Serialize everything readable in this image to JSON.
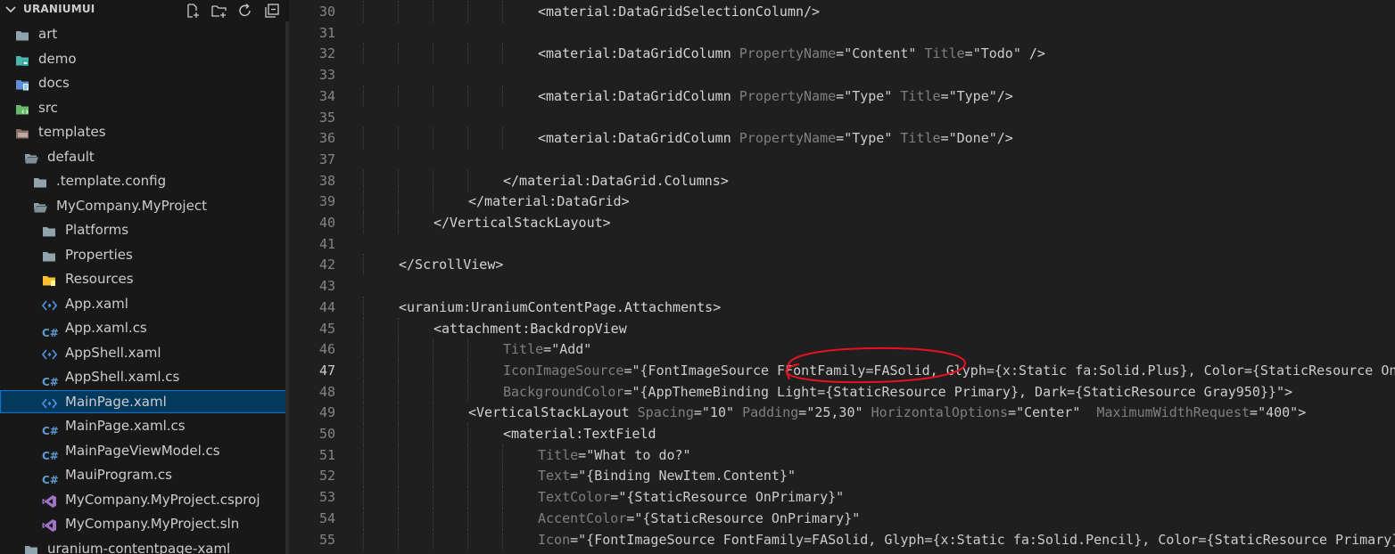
{
  "explorer": {
    "title": "URANIUMUI",
    "actions": [
      "new-file-icon",
      "new-folder-icon",
      "refresh-icon",
      "collapse-all-icon"
    ],
    "items": [
      {
        "label": "art",
        "icon": "folder-icon",
        "depth": 0
      },
      {
        "label": "demo",
        "icon": "folder-demo-icon",
        "depth": 0
      },
      {
        "label": "docs",
        "icon": "folder-docs-icon",
        "depth": 0
      },
      {
        "label": "src",
        "icon": "folder-src-icon",
        "depth": 0
      },
      {
        "label": "templates",
        "icon": "folder-templates-icon",
        "depth": 0
      },
      {
        "label": "default",
        "icon": "folder-open-icon",
        "depth": 1
      },
      {
        "label": ".template.config",
        "icon": "folder-icon",
        "depth": 2
      },
      {
        "label": "MyCompany.MyProject",
        "icon": "folder-open-icon",
        "depth": 2
      },
      {
        "label": "Platforms",
        "icon": "folder-icon",
        "depth": 3
      },
      {
        "label": "Properties",
        "icon": "folder-icon",
        "depth": 3
      },
      {
        "label": "Resources",
        "icon": "folder-resources-icon",
        "depth": 3
      },
      {
        "label": "App.xaml",
        "icon": "xaml-icon",
        "depth": 3
      },
      {
        "label": "App.xaml.cs",
        "icon": "csharp-icon",
        "depth": 3
      },
      {
        "label": "AppShell.xaml",
        "icon": "xaml-icon",
        "depth": 3
      },
      {
        "label": "AppShell.xaml.cs",
        "icon": "csharp-icon",
        "depth": 3
      },
      {
        "label": "MainPage.xaml",
        "icon": "xaml-icon",
        "depth": 3,
        "selected": true
      },
      {
        "label": "MainPage.xaml.cs",
        "icon": "csharp-icon",
        "depth": 3
      },
      {
        "label": "MainPageViewModel.cs",
        "icon": "csharp-icon",
        "depth": 3
      },
      {
        "label": "MauiProgram.cs",
        "icon": "csharp-icon",
        "depth": 3
      },
      {
        "label": "MyCompany.MyProject.csproj",
        "icon": "visual-studio-icon",
        "depth": 3
      },
      {
        "label": "MyCompany.MyProject.sln",
        "icon": "visual-studio-icon",
        "depth": 3
      },
      {
        "label": "uranium-contentpage-xaml",
        "icon": "folder-icon",
        "depth": 1
      }
    ]
  },
  "editor": {
    "active_line": "47",
    "annotation": "red-circle-highlight",
    "lines": [
      {
        "n": "30",
        "guides": 5,
        "tokens": [
          {
            "k": "t",
            "v": "<material:DataGridSelectionColumn/>"
          }
        ]
      },
      {
        "n": "31",
        "guides": 0,
        "tokens": []
      },
      {
        "n": "32",
        "guides": 5,
        "tokens": [
          {
            "k": "t",
            "v": "<material:DataGridColumn "
          },
          {
            "k": "a",
            "v": "PropertyName"
          },
          {
            "k": "t",
            "v": "="
          },
          {
            "k": "s",
            "v": "\"Content\""
          },
          {
            "k": "t",
            "v": " "
          },
          {
            "k": "a",
            "v": "Title"
          },
          {
            "k": "t",
            "v": "="
          },
          {
            "k": "s",
            "v": "\"Todo\""
          },
          {
            "k": "t",
            "v": " />"
          }
        ]
      },
      {
        "n": "33",
        "guides": 0,
        "tokens": []
      },
      {
        "n": "34",
        "guides": 5,
        "tokens": [
          {
            "k": "t",
            "v": "<material:DataGridColumn "
          },
          {
            "k": "a",
            "v": "PropertyName"
          },
          {
            "k": "t",
            "v": "="
          },
          {
            "k": "s",
            "v": "\"Type\""
          },
          {
            "k": "t",
            "v": " "
          },
          {
            "k": "a",
            "v": "Title"
          },
          {
            "k": "t",
            "v": "="
          },
          {
            "k": "s",
            "v": "\"Type\""
          },
          {
            "k": "t",
            "v": "/>"
          }
        ]
      },
      {
        "n": "35",
        "guides": 0,
        "tokens": []
      },
      {
        "n": "36",
        "guides": 5,
        "tokens": [
          {
            "k": "t",
            "v": "<material:DataGridColumn "
          },
          {
            "k": "a",
            "v": "PropertyName"
          },
          {
            "k": "t",
            "v": "="
          },
          {
            "k": "s",
            "v": "\"Type\""
          },
          {
            "k": "t",
            "v": " "
          },
          {
            "k": "a",
            "v": "Title"
          },
          {
            "k": "t",
            "v": "="
          },
          {
            "k": "s",
            "v": "\"Done\""
          },
          {
            "k": "t",
            "v": "/>"
          }
        ]
      },
      {
        "n": "37",
        "guides": 0,
        "tokens": []
      },
      {
        "n": "38",
        "guides": 4,
        "tokens": [
          {
            "k": "t",
            "v": "</material:DataGrid.Columns>"
          }
        ]
      },
      {
        "n": "39",
        "guides": 3,
        "tokens": [
          {
            "k": "t",
            "v": "</material:DataGrid>"
          }
        ]
      },
      {
        "n": "40",
        "guides": 2,
        "tokens": [
          {
            "k": "t",
            "v": "</VerticalStackLayout>"
          }
        ]
      },
      {
        "n": "41",
        "guides": 0,
        "tokens": []
      },
      {
        "n": "42",
        "guides": 1,
        "tokens": [
          {
            "k": "t",
            "v": "</ScrollView>"
          }
        ]
      },
      {
        "n": "43",
        "guides": 0,
        "tokens": []
      },
      {
        "n": "44",
        "guides": 1,
        "tokens": [
          {
            "k": "t",
            "v": "<uranium:UraniumContentPage.Attachments>"
          }
        ]
      },
      {
        "n": "45",
        "guides": 2,
        "tokens": [
          {
            "k": "t",
            "v": "<attachment:BackdropView"
          }
        ]
      },
      {
        "n": "46",
        "guides": 4,
        "tokens": [
          {
            "k": "a",
            "v": "Title"
          },
          {
            "k": "t",
            "v": "="
          },
          {
            "k": "s",
            "v": "\"Add\""
          }
        ]
      },
      {
        "n": "47",
        "guides": 4,
        "tokens": [
          {
            "k": "a",
            "v": "IconImageSource"
          },
          {
            "k": "t",
            "v": "="
          },
          {
            "k": "s",
            "v": "\"{FontImageSource FFontFamily=FASolid, Glyph={x:Static fa:Solid.Plus}, Color={StaticResource OnPrimary}}\""
          }
        ]
      },
      {
        "n": "48",
        "guides": 4,
        "tokens": [
          {
            "k": "a",
            "v": "BackgroundColor"
          },
          {
            "k": "t",
            "v": "="
          },
          {
            "k": "s",
            "v": "\"{AppThemeBinding Light={StaticResource Primary}, Dark={StaticResource Gray950}}\""
          },
          {
            "k": "t",
            "v": ">"
          }
        ]
      },
      {
        "n": "49",
        "guides": 3,
        "tokens": [
          {
            "k": "t",
            "v": "<VerticalStackLayout "
          },
          {
            "k": "a",
            "v": "Spacing"
          },
          {
            "k": "t",
            "v": "="
          },
          {
            "k": "s",
            "v": "\"10\""
          },
          {
            "k": "t",
            "v": " "
          },
          {
            "k": "a",
            "v": "Padding"
          },
          {
            "k": "t",
            "v": "="
          },
          {
            "k": "s",
            "v": "\"25,30\""
          },
          {
            "k": "t",
            "v": " "
          },
          {
            "k": "a",
            "v": "HorizontalOptions"
          },
          {
            "k": "t",
            "v": "="
          },
          {
            "k": "s",
            "v": "\"Center\""
          },
          {
            "k": "t",
            "v": "  "
          },
          {
            "k": "a",
            "v": "MaximumWidthRequest"
          },
          {
            "k": "t",
            "v": "="
          },
          {
            "k": "s",
            "v": "\"400\""
          },
          {
            "k": "t",
            "v": ">"
          }
        ]
      },
      {
        "n": "50",
        "guides": 4,
        "tokens": [
          {
            "k": "t",
            "v": "<material:TextField"
          }
        ]
      },
      {
        "n": "51",
        "guides": 5,
        "tokens": [
          {
            "k": "a",
            "v": "Title"
          },
          {
            "k": "t",
            "v": "="
          },
          {
            "k": "s",
            "v": "\"What to do?\""
          }
        ]
      },
      {
        "n": "52",
        "guides": 5,
        "tokens": [
          {
            "k": "a",
            "v": "Text"
          },
          {
            "k": "t",
            "v": "="
          },
          {
            "k": "s",
            "v": "\"{Binding NewItem.Content}\""
          }
        ]
      },
      {
        "n": "53",
        "guides": 5,
        "tokens": [
          {
            "k": "a",
            "v": "TextColor"
          },
          {
            "k": "t",
            "v": "="
          },
          {
            "k": "s",
            "v": "\"{StaticResource OnPrimary}\""
          }
        ]
      },
      {
        "n": "54",
        "guides": 5,
        "tokens": [
          {
            "k": "a",
            "v": "AccentColor"
          },
          {
            "k": "t",
            "v": "="
          },
          {
            "k": "s",
            "v": "\"{StaticResource OnPrimary}\""
          }
        ]
      },
      {
        "n": "55",
        "guides": 5,
        "tokens": [
          {
            "k": "a",
            "v": "Icon"
          },
          {
            "k": "t",
            "v": "="
          },
          {
            "k": "s",
            "v": "\"{FontImageSource FontFamily=FASolid, Glyph={x:Static fa:Solid.Pencil}, Color={StaticResource Primary}}\""
          }
        ]
      }
    ]
  }
}
